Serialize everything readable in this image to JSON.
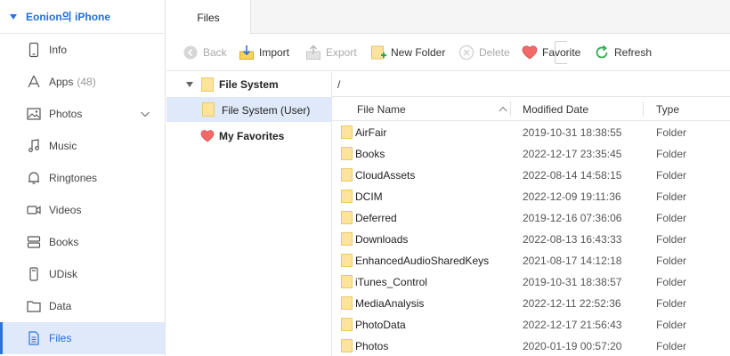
{
  "device": {
    "name": "Eonion의 iPhone"
  },
  "sidebar": {
    "items": [
      {
        "label": "Info",
        "icon": "phone-icon"
      },
      {
        "label": "Apps",
        "count": "(48)",
        "icon": "apps-icon"
      },
      {
        "label": "Photos",
        "icon": "photo-icon"
      },
      {
        "label": "Music",
        "icon": "music-icon"
      },
      {
        "label": "Ringtones",
        "icon": "bell-icon"
      },
      {
        "label": "Videos",
        "icon": "video-icon"
      },
      {
        "label": "Books",
        "icon": "book-icon"
      },
      {
        "label": "UDisk",
        "icon": "udisk-icon"
      },
      {
        "label": "Data",
        "icon": "folder-icon"
      },
      {
        "label": "Files",
        "icon": "file-icon"
      }
    ]
  },
  "tabs": {
    "files": "Files"
  },
  "toolbar": {
    "back": "Back",
    "import": "Import",
    "export": "Export",
    "new_folder": "New Folder",
    "delete": "Delete",
    "favorite": "Favorite",
    "refresh": "Refresh"
  },
  "tree": {
    "root": "File System",
    "user": "File System (User)",
    "favorites": "My Favorites"
  },
  "path": "/",
  "columns": {
    "name": "File Name",
    "date": "Modified Date",
    "type": "Type"
  },
  "files": [
    {
      "name": "AirFair",
      "date": "2019-10-31 18:38:55",
      "type": "Folder"
    },
    {
      "name": "Books",
      "date": "2022-12-17 23:35:45",
      "type": "Folder"
    },
    {
      "name": "CloudAssets",
      "date": "2022-08-14 14:58:15",
      "type": "Folder"
    },
    {
      "name": "DCIM",
      "date": "2022-12-09 19:11:36",
      "type": "Folder"
    },
    {
      "name": "Deferred",
      "date": "2019-12-16 07:36:06",
      "type": "Folder"
    },
    {
      "name": "Downloads",
      "date": "2022-08-13 16:43:33",
      "type": "Folder"
    },
    {
      "name": "EnhancedAudioSharedKeys",
      "date": "2021-08-17 14:12:18",
      "type": "Folder"
    },
    {
      "name": "iTunes_Control",
      "date": "2019-10-31 18:38:57",
      "type": "Folder"
    },
    {
      "name": "MediaAnalysis",
      "date": "2022-12-11 22:52:36",
      "type": "Folder"
    },
    {
      "name": "PhotoData",
      "date": "2022-12-17 21:56:43",
      "type": "Folder"
    },
    {
      "name": "Photos",
      "date": "2020-01-19 00:57:20",
      "type": "Folder"
    }
  ],
  "colors": {
    "accent": "#2b74d6",
    "selected_bg": "#dfe9f9",
    "folder": "#fde49a"
  }
}
